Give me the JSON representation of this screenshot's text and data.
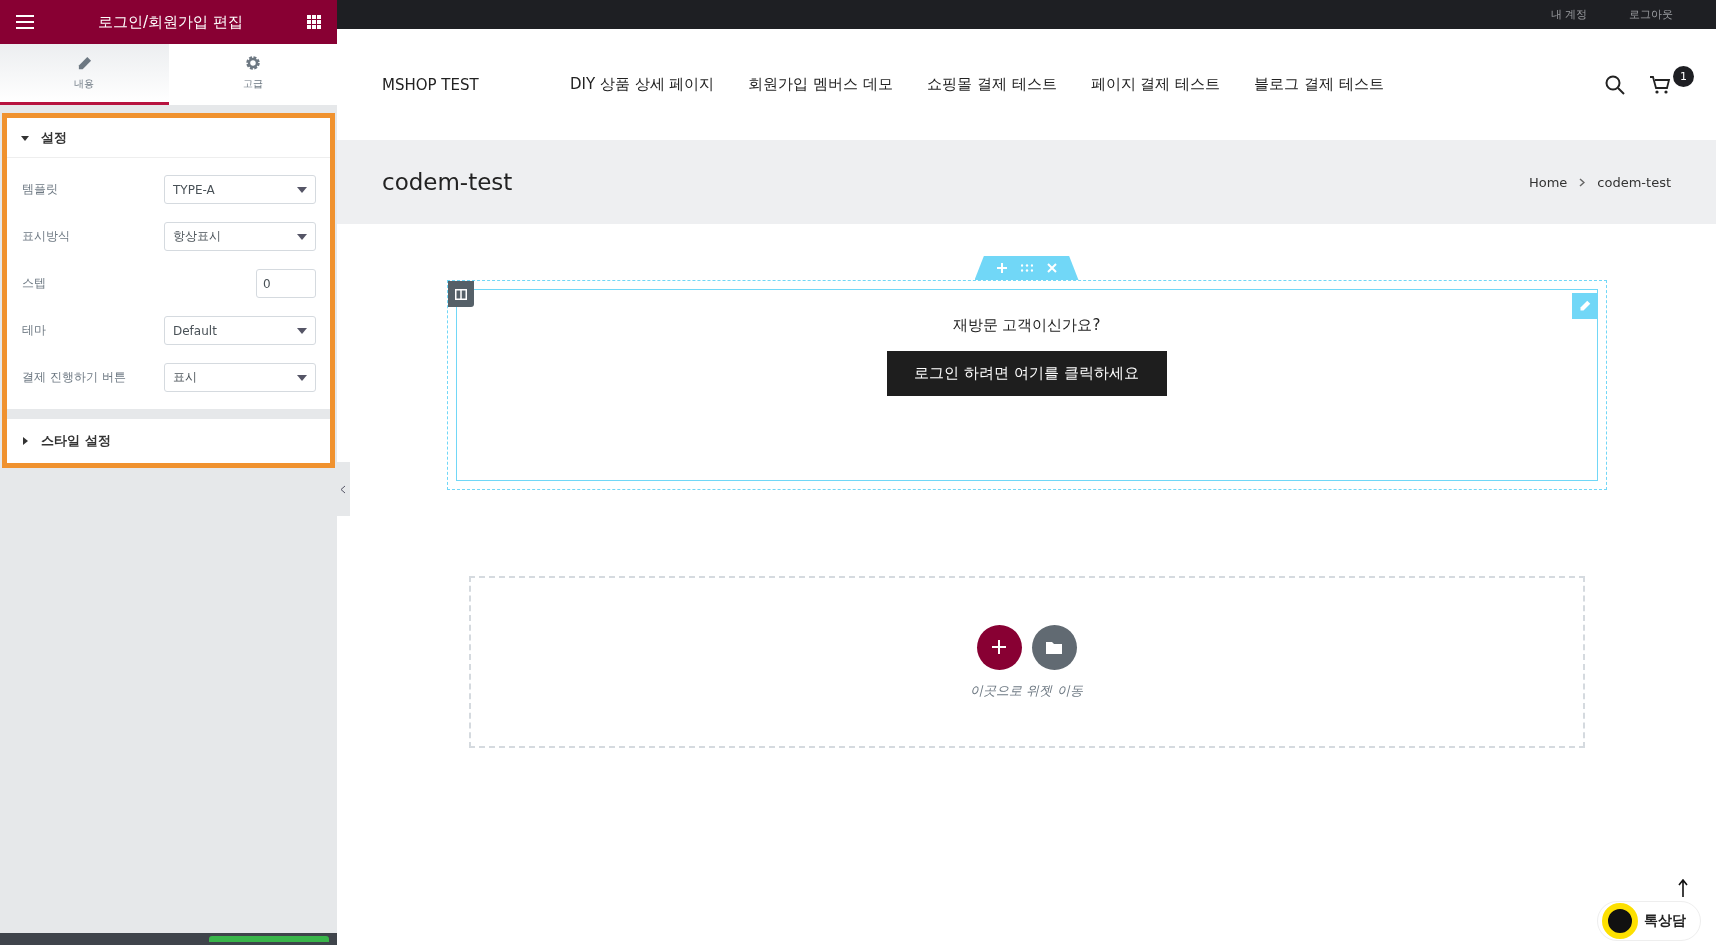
{
  "editor_panel": {
    "title": "로그인/회원가입 편집",
    "tabs": [
      {
        "label": "내용",
        "selected": true
      },
      {
        "label": "고급",
        "selected": false
      }
    ],
    "sections": [
      {
        "title": "설정",
        "expanded": true,
        "controls": [
          {
            "kind": "select",
            "label": "템플릿",
            "value": "TYPE-A"
          },
          {
            "kind": "select",
            "label": "표시방식",
            "value": "항상표시"
          },
          {
            "kind": "number",
            "label": "스텝",
            "value": "0"
          },
          {
            "kind": "select",
            "label": "테마",
            "value": "Default"
          },
          {
            "kind": "select",
            "label": "결제 진행하기 버튼",
            "value": "표시"
          }
        ]
      },
      {
        "title": "스타일 설정",
        "expanded": false
      }
    ]
  },
  "top_bar": {
    "links": [
      "내 계정",
      "로그아웃"
    ]
  },
  "site_header": {
    "logo": "MSHOP TEST",
    "nav": [
      "DIY 상품 상세 페이지",
      "회원가입 멤버스 데모",
      "쇼핑몰 결제 테스트",
      "페이지 결제 테스트",
      "블로그 결제 테스트"
    ],
    "cart_count": "1"
  },
  "page_title_bar": {
    "title": "codem-test",
    "breadcrumb": [
      "Home",
      "codem-test"
    ]
  },
  "login_widget": {
    "question": "재방문 고객이신가요?",
    "button": "로그인 하려면 여기를 클릭하세요"
  },
  "drop_zone": {
    "hint": "이곳으로 위젯 이동"
  },
  "chat_badge": {
    "label": "톡상담"
  }
}
